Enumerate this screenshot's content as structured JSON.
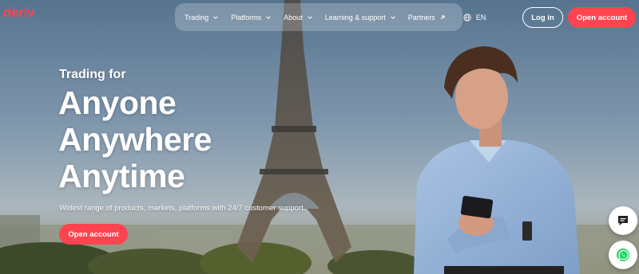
{
  "brand": {
    "logo_text": "deriv",
    "accent_color": "#ff444f"
  },
  "nav": {
    "items": [
      {
        "label": "Trading",
        "icon": "chevron-down-icon"
      },
      {
        "label": "Platforms",
        "icon": "chevron-down-icon"
      },
      {
        "label": "About",
        "icon": "chevron-down-icon"
      },
      {
        "label": "Learning & support",
        "icon": "chevron-down-icon"
      },
      {
        "label": "Partners",
        "icon": "external-arrow-icon"
      }
    ],
    "language": {
      "label": "EN",
      "icon": "globe-icon"
    }
  },
  "auth": {
    "login_label": "Log in",
    "open_account_label": "Open account"
  },
  "hero": {
    "eyebrow": "Trading for",
    "lines": [
      "Anyone",
      "Anywhere",
      "Anytime"
    ],
    "subtitle": "Widest range of products, markets, platforms with 24/7 customer support.",
    "cta_label": "Open account"
  },
  "floating": {
    "chat_icon": "chat-bubble-icon",
    "whatsapp_icon": "whatsapp-icon"
  }
}
